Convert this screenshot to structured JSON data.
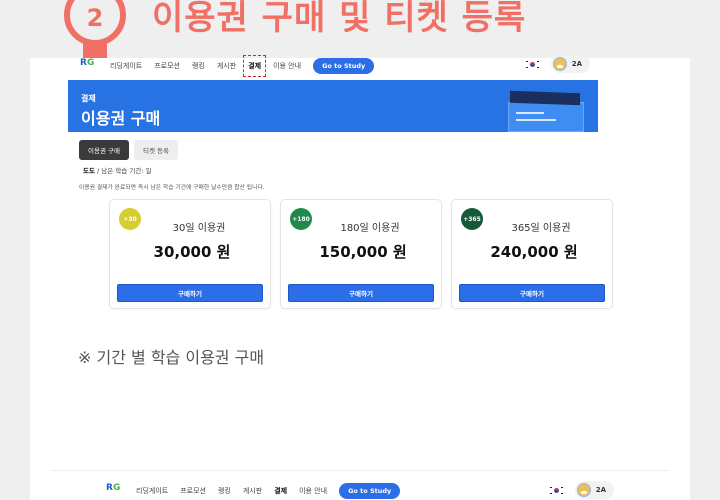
{
  "heading": {
    "step_number": "2",
    "title": "이용권 구매 및 티켓 등록"
  },
  "nav": {
    "logo": "RG",
    "items": [
      "리딩게이트",
      "프로모션",
      "랭킹",
      "게시판",
      "결제",
      "이용 안내"
    ],
    "study_button": "Go to Study",
    "user_name": "2A"
  },
  "banner": {
    "kicker": "결제",
    "title": "이용권 구매"
  },
  "tabs": [
    "이용권 구매",
    "티켓 등록"
  ],
  "remaining": {
    "user": "도도",
    "text": "/ 남은 학습 기간: 일"
  },
  "notice": "이용권 결제가 완료되면 즉시 남은 학습 기간에 구매한 날수만큼 합산 됩니다.",
  "plans": [
    {
      "badge": "+30",
      "badge_color": "#d6cd2e",
      "name": "30일 이용권",
      "price": "30,000 원",
      "button": "구매하기"
    },
    {
      "badge": "+180",
      "badge_color": "#1f8a4c",
      "name": "180일 이용권",
      "price": "150,000 원",
      "button": "구매하기"
    },
    {
      "badge": "+365",
      "badge_color": "#145a38",
      "name": "365일 이용권",
      "price": "240,000 원",
      "button": "구매하기"
    }
  ],
  "caption": "※ 기간 별 학습 이용권 구매",
  "colors": {
    "accent": "#f07065",
    "primary": "#2b6ee8",
    "banner": "#2873e4"
  }
}
